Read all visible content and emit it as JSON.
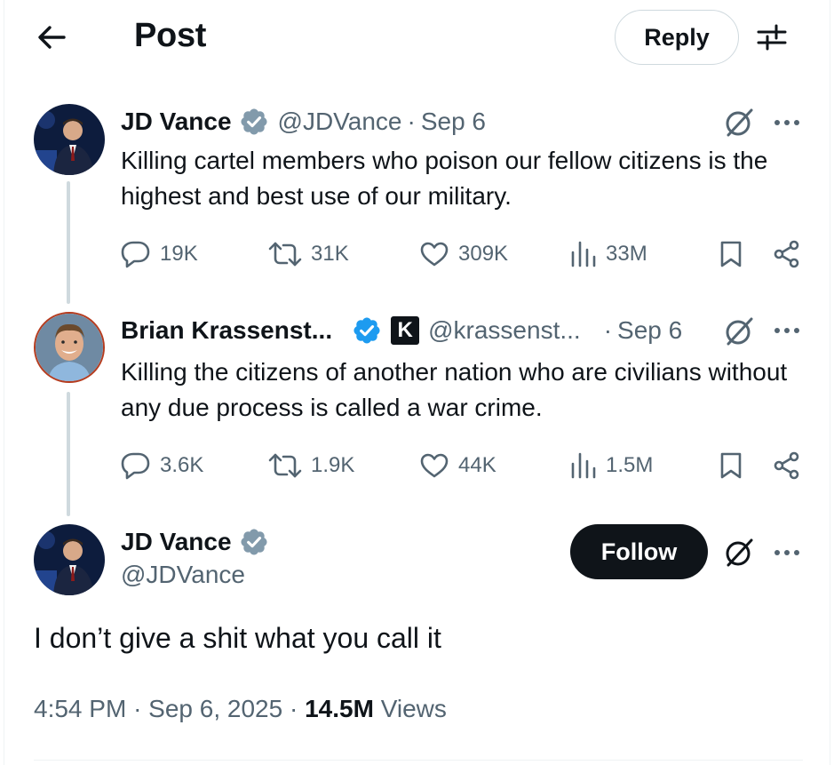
{
  "header": {
    "title": "Post",
    "reply_label": "Reply"
  },
  "colors": {
    "verified_gray": "#829aab",
    "verified_blue": "#1d9bf0",
    "thread_line": "#cfd9de",
    "secondary_text": "#536471",
    "follow_bg": "#0f1419"
  },
  "tweets": [
    {
      "name": "JD Vance",
      "handle": "@JDVance",
      "separator": "·",
      "date": "Sep 6",
      "badge": "verified-gray",
      "text": "Killing cartel members who poison our fellow citizens is the highest and best use of our military.",
      "stats": {
        "replies": "19K",
        "reposts": "31K",
        "likes": "309K",
        "views": "33M"
      }
    },
    {
      "name": "Brian Krassenst...",
      "handle": "@krassenst...",
      "separator": "·",
      "date": "Sep 6",
      "badge": "verified-blue",
      "affiliate": "K",
      "text": "Killing the citizens of another nation who are civilians without any due process is called a war crime.",
      "stats": {
        "replies": "3.6K",
        "reposts": "1.9K",
        "likes": "44K",
        "views": "1.5M"
      }
    }
  ],
  "main": {
    "name": "JD Vance",
    "handle": "@JDVance",
    "badge": "verified-gray",
    "follow_label": "Follow",
    "text": "I don’t give a shit what you call it",
    "time": "4:54 PM",
    "separator": "·",
    "date": "Sep 6, 2025",
    "views_count": "14.5M",
    "views_label": "Views"
  },
  "icons": [
    "back-arrow-icon",
    "settings-sliders-icon",
    "grok-icon",
    "more-icon",
    "reply-icon",
    "repost-icon",
    "like-icon",
    "views-icon",
    "bookmark-icon",
    "share-icon"
  ]
}
